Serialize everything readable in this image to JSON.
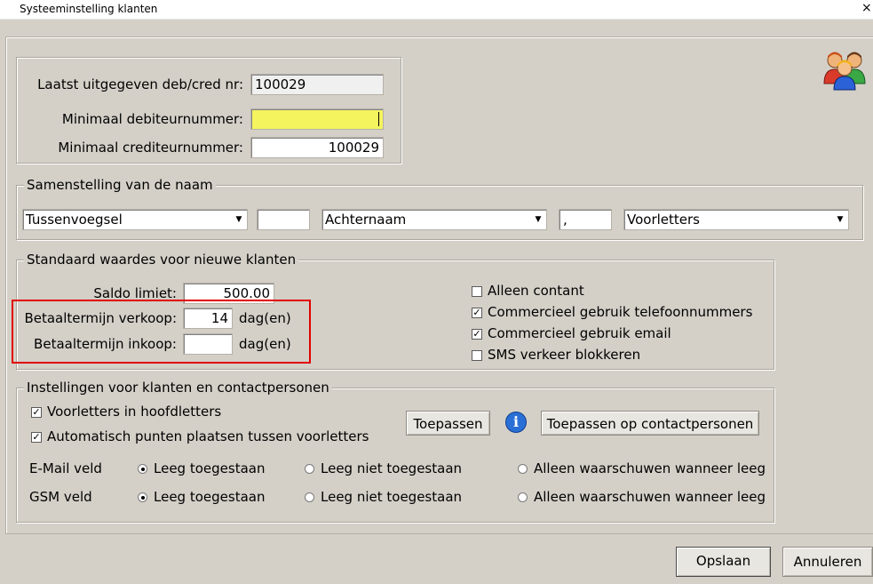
{
  "window": {
    "title": "Systeeminstelling klanten",
    "close_glyph": "×"
  },
  "numbers_group": {
    "last_issued_label": "Laatst uitgegeven deb/cred nr:",
    "last_issued_value": "100029",
    "min_debtor_label": "Minimaal debiteurnummer:",
    "min_debtor_value": "",
    "min_creditor_label": "Minimaal crediteurnummer:",
    "min_creditor_value": "100029"
  },
  "name_group": {
    "legend": "Samenstelling van de naam",
    "part1": "Tussenvoegsel",
    "sep1": "",
    "part2": "Achternaam",
    "sep2": ",",
    "part3": "Voorletters"
  },
  "defaults_group": {
    "legend": "Standaard waardes voor nieuwe klanten",
    "saldo_label": "Saldo limiet:",
    "saldo_value": "500.00",
    "sale_term_label": "Betaaltermijn verkoop:",
    "sale_term_value": "14",
    "sale_term_unit": "dag(en)",
    "purchase_term_label": "Betaaltermijn inkoop:",
    "purchase_term_value": "",
    "purchase_term_unit": "dag(en)",
    "checks": [
      {
        "label": "Alleen contant",
        "checked": false
      },
      {
        "label": "Commercieel gebruik telefoonnummers",
        "checked": true
      },
      {
        "label": "Commercieel gebruik email",
        "checked": true
      },
      {
        "label": "SMS verkeer blokkeren",
        "checked": false
      }
    ]
  },
  "contact_group": {
    "legend": "Instellingen voor klanten en contactpersonen",
    "checks": [
      {
        "label": "Voorletters in hoofdletters",
        "checked": true
      },
      {
        "label": "Automatisch punten plaatsen tussen voorletters",
        "checked": true
      }
    ],
    "apply_button": "Toepassen",
    "info_glyph": "i",
    "apply_contacts_button": "Toepassen op contactpersonen",
    "email_label": "E-Mail veld",
    "gsm_label": "GSM veld",
    "radio_options": [
      "Leeg toegestaan",
      "Leeg niet toegestaan",
      "Alleen waarschuwen wanneer leeg"
    ],
    "email_selected": 0,
    "gsm_selected": 0
  },
  "footer": {
    "save_button": "Opslaan",
    "cancel_button": "Annuleren"
  },
  "icons": {
    "users": "users-icon",
    "info": "info-icon"
  },
  "colors": {
    "highlight": "#e00000",
    "required_field": "#f4f45e",
    "info_blue": "#2a6fd6"
  }
}
